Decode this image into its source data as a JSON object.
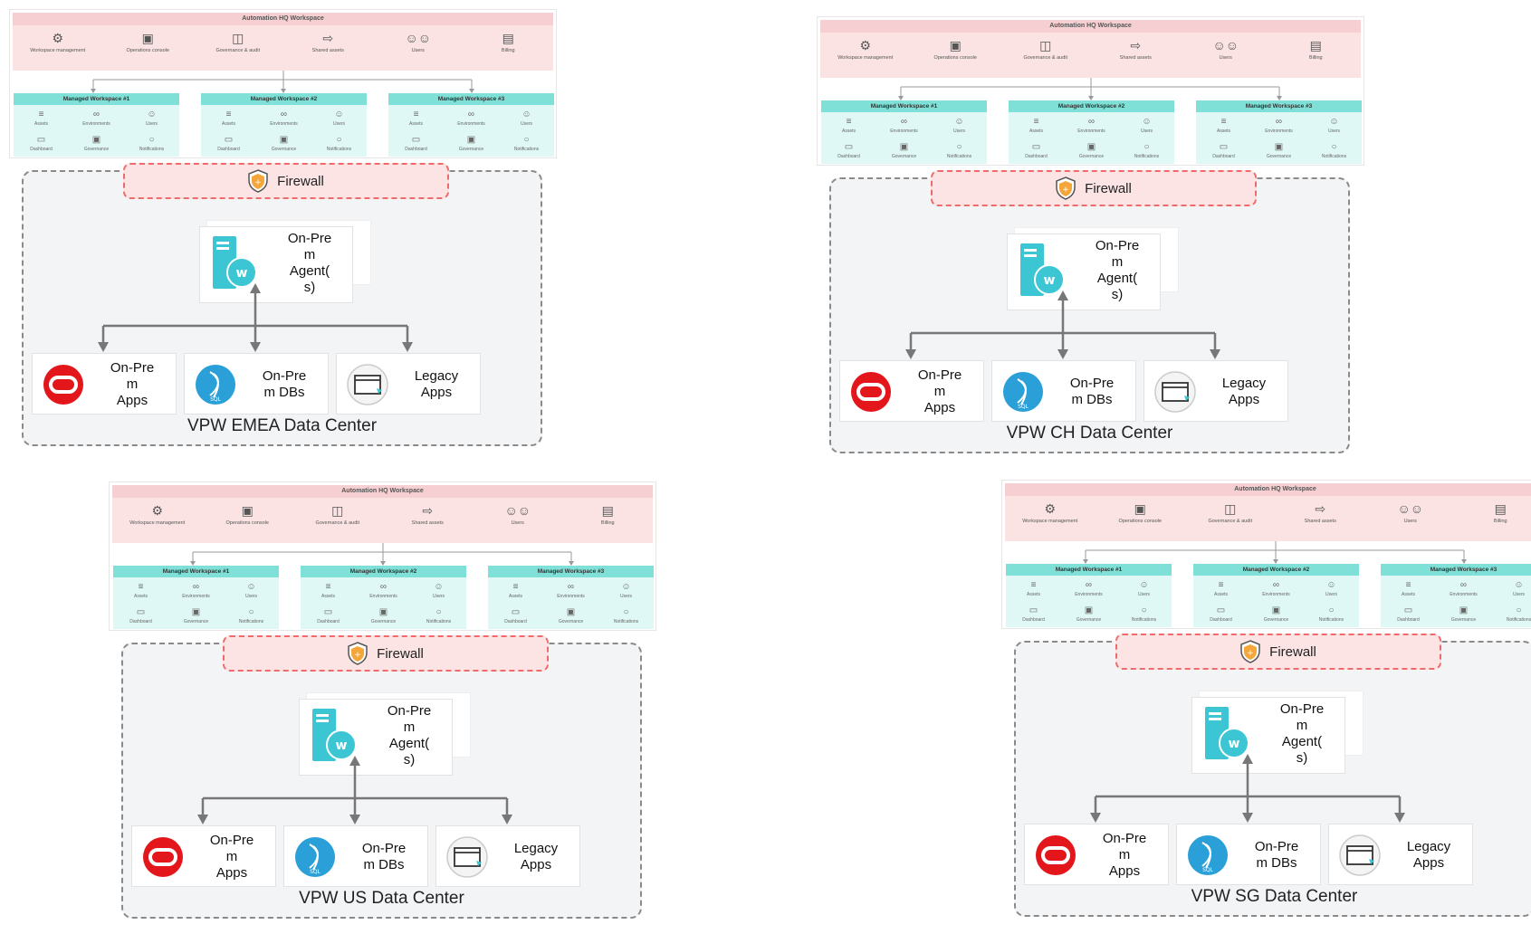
{
  "workspace": {
    "title": "Automation HQ Workspace",
    "hq_items": [
      {
        "icon": "workspace-management-icon",
        "label": "Workspace management"
      },
      {
        "icon": "operations-console-icon",
        "label": "Operations console"
      },
      {
        "icon": "governance-audit-icon",
        "label": "Governance & audit"
      },
      {
        "icon": "shared-assets-icon",
        "label": "Shared assets"
      },
      {
        "icon": "users-icon",
        "label": "Users"
      },
      {
        "icon": "billing-icon",
        "label": "Billing"
      }
    ],
    "managed": [
      {
        "title": "Managed Workspace #1"
      },
      {
        "title": "Managed Workspace #2"
      },
      {
        "title": "Managed Workspace #3"
      }
    ],
    "managed_items": [
      {
        "icon": "assets-icon",
        "label": "Assets"
      },
      {
        "icon": "environments-icon",
        "label": "Environments"
      },
      {
        "icon": "users-icon",
        "label": "Users"
      },
      {
        "icon": "dashboard-icon",
        "label": "Dashboard"
      },
      {
        "icon": "governance-icon",
        "label": "Governance"
      },
      {
        "icon": "notifications-icon",
        "label": "Notifications"
      }
    ]
  },
  "firewall_label": "Firewall",
  "agent_label": "On-Pre\nm\nAgent(\ns)",
  "apps_label": "On-Pre\nm\nApps",
  "dbs_label": "On-Pre\nm DBs",
  "legacy_label": "Legacy\nApps",
  "colors": {
    "hq_title_bg": "#f5cfd1",
    "hq_body_bg": "#fbe3e3",
    "managed_title_bg": "#7ee0d6",
    "managed_body_bg": "#dff8f5",
    "firewall_border": "#ef6b6b",
    "firewall_bg": "#fde4e4",
    "datacenter_bg": "#f3f4f6",
    "oracle_red": "#e3171b",
    "sql_blue": "#2a9fd8",
    "agent_teal": "#3cc6d3"
  },
  "datacenters": [
    {
      "title": "VPW EMEA Data Center"
    },
    {
      "title": "VPW CH Data Center"
    },
    {
      "title": "VPW US Data Center"
    },
    {
      "title": "VPW SG Data Center"
    }
  ]
}
